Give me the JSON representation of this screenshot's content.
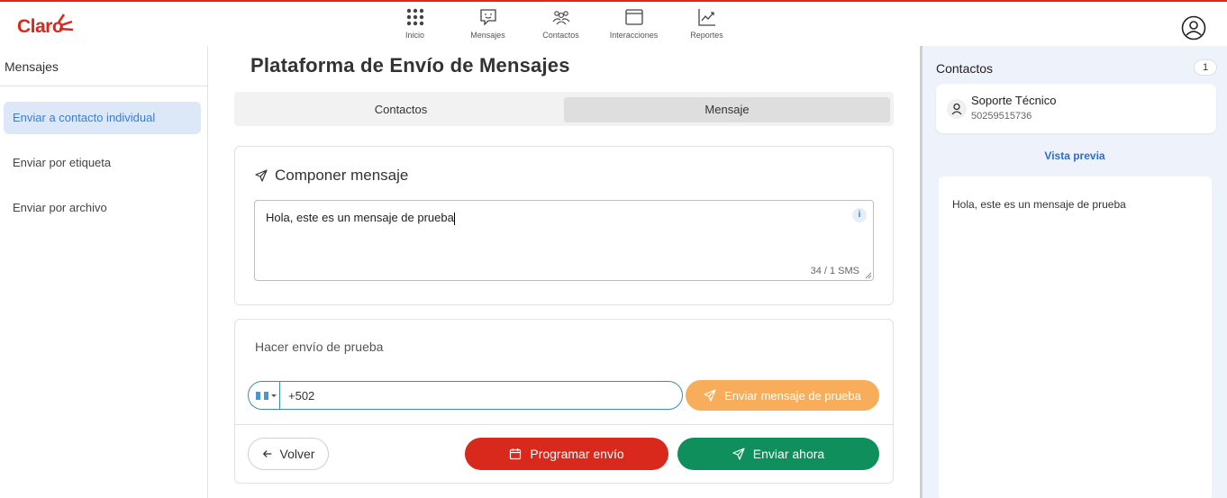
{
  "brand": {
    "logo_text": "Claro"
  },
  "nav": {
    "items": [
      {
        "label": "Inicio",
        "icon": "grid-icon"
      },
      {
        "label": "Mensajes",
        "icon": "message-icon"
      },
      {
        "label": "Contactos",
        "icon": "contacts-icon"
      },
      {
        "label": "Interacciones",
        "icon": "window-icon"
      },
      {
        "label": "Reportes",
        "icon": "chart-icon"
      }
    ]
  },
  "sidebar": {
    "title": "Mensajes",
    "items": [
      {
        "label": "Enviar a contacto individual",
        "active": true
      },
      {
        "label": "Enviar por etiqueta",
        "active": false
      },
      {
        "label": "Enviar por archivo",
        "active": false
      }
    ]
  },
  "main": {
    "title": "Plataforma de Envío de Mensajes",
    "tabs": [
      {
        "label": "Contactos",
        "active": false
      },
      {
        "label": "Mensaje",
        "active": true
      }
    ],
    "compose": {
      "title": "Componer mensaje",
      "message": "Hola, este es un mensaje de prueba",
      "info_symbol": "i",
      "counter": "34 / 1 SMS"
    },
    "test_send": {
      "title": "Hacer envío de prueba",
      "phone_value": "+502",
      "button_label": "Enviar mensaje de prueba"
    },
    "actions": {
      "back_label": "Volver",
      "schedule_label": "Programar envío",
      "send_label": "Enviar ahora"
    }
  },
  "right_panel": {
    "title": "Contactos",
    "count": "1",
    "contact": {
      "name": "Soporte Técnico",
      "phone": "50259515736"
    },
    "preview_link": "Vista previa",
    "preview_text": "Hola, este es un mensaje de prueba"
  },
  "colors": {
    "brand_red": "#da291c",
    "test_orange": "#f8ad5a",
    "send_green": "#0f8f5c",
    "active_blue": "#3d7bd0"
  }
}
